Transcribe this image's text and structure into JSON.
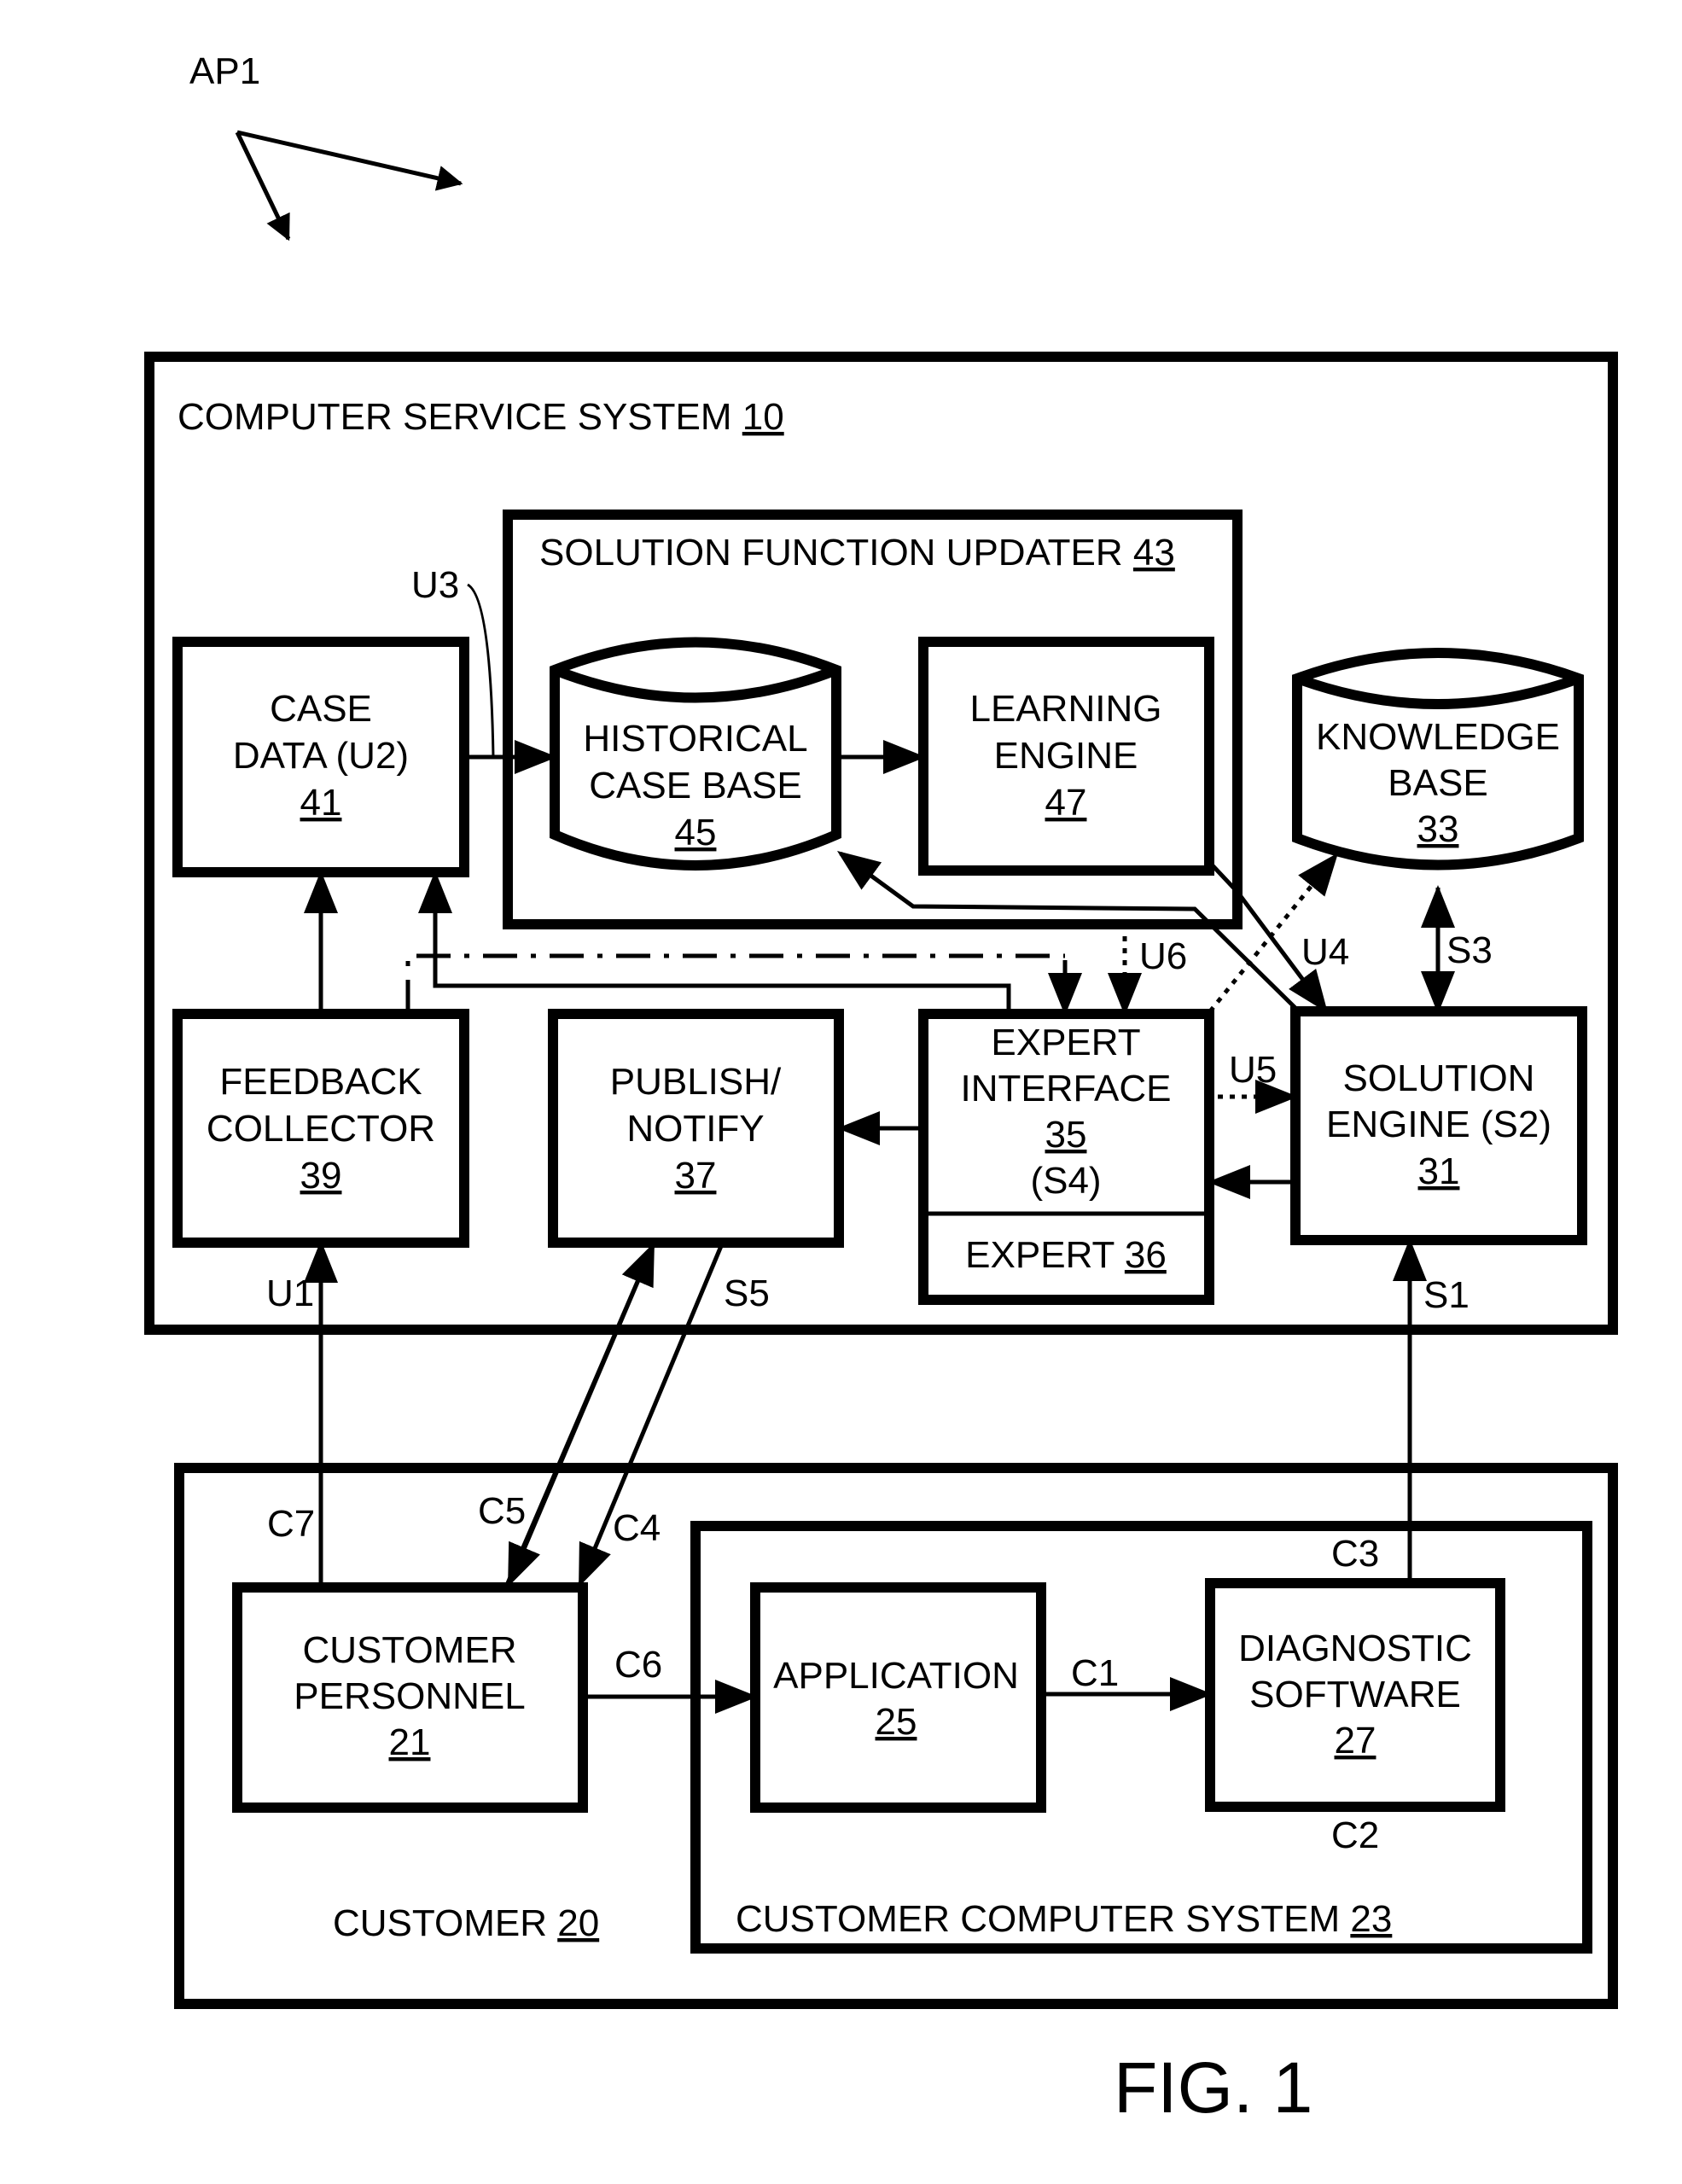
{
  "figure_ref": "AP1",
  "figure_label": "FIG. 1",
  "systems": {
    "computer_service_system": {
      "label": "COMPUTER SERVICE SYSTEM",
      "num": "10"
    },
    "solution_function_updater": {
      "label": "SOLUTION FUNCTION UPDATER",
      "num": "43"
    },
    "customer": {
      "label": "CUSTOMER",
      "num": "20"
    },
    "customer_computer_system": {
      "label": "CUSTOMER COMPUTER SYSTEM",
      "num": "23"
    }
  },
  "blocks": {
    "case_data": {
      "lines": [
        "CASE",
        "DATA (U2)"
      ],
      "num": "41"
    },
    "historical_case_base": {
      "lines": [
        "HISTORICAL",
        "CASE BASE"
      ],
      "num": "45"
    },
    "learning_engine": {
      "lines": [
        "LEARNING",
        "ENGINE"
      ],
      "num": "47"
    },
    "knowledge_base": {
      "lines": [
        "KNOWLEDGE",
        "BASE"
      ],
      "num": "33"
    },
    "feedback_collector": {
      "lines": [
        "FEEDBACK",
        "COLLECTOR"
      ],
      "num": "39"
    },
    "publish_notify": {
      "lines": [
        "PUBLISH/",
        "NOTIFY"
      ],
      "num": "37"
    },
    "expert_interface": {
      "lines": [
        "EXPERT",
        "INTERFACE"
      ],
      "num": "35",
      "extra": "(S4)"
    },
    "expert": {
      "label": "EXPERT",
      "num": "36"
    },
    "solution_engine": {
      "lines": [
        "SOLUTION",
        "ENGINE (S2)"
      ],
      "num": "31"
    },
    "customer_personnel": {
      "lines": [
        "CUSTOMER",
        "PERSONNEL"
      ],
      "num": "21"
    },
    "application": {
      "lines": [
        "APPLICATION"
      ],
      "num": "25"
    },
    "diagnostic_software": {
      "lines": [
        "DIAGNOSTIC",
        "SOFTWARE"
      ],
      "num": "27"
    }
  },
  "signals": {
    "U1": "U1",
    "U3": "U3",
    "U4": "U4",
    "U5": "U5",
    "U6": "U6",
    "S1": "S1",
    "S3": "S3",
    "S5": "S5",
    "C1": "C1",
    "C2": "C2",
    "C3": "C3",
    "C4": "C4",
    "C5": "C5",
    "C6": "C6",
    "C7": "C7"
  }
}
